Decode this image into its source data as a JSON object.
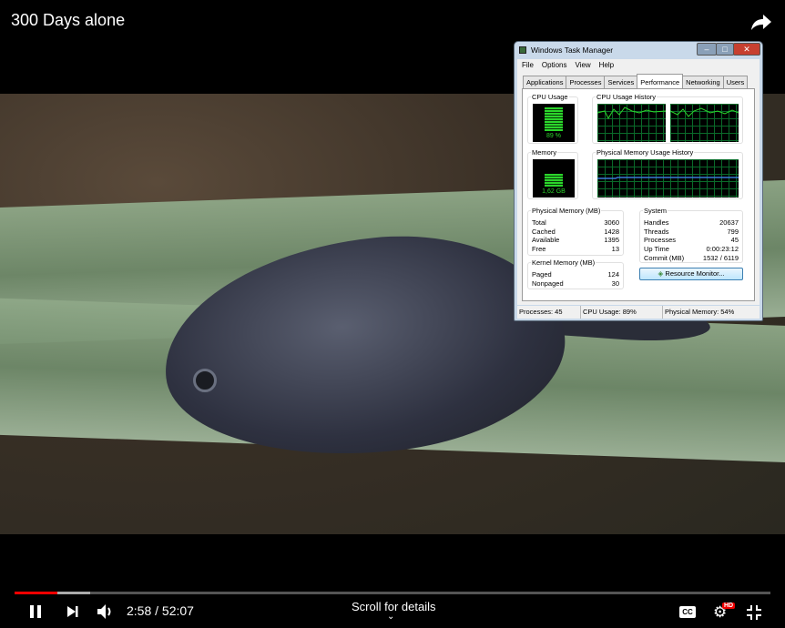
{
  "video": {
    "title": "300 Days alone",
    "share_icon": "share-icon"
  },
  "task_manager": {
    "title": "Windows Task Manager",
    "window_buttons": {
      "minimize": "–",
      "maximize": "□",
      "close": "✕"
    },
    "menu": [
      "File",
      "Options",
      "View",
      "Help"
    ],
    "tabs": [
      "Applications",
      "Processes",
      "Services",
      "Performance",
      "Networking",
      "Users"
    ],
    "active_tab": "Performance",
    "cpu_usage": {
      "label": "CPU Usage",
      "value": "89 %",
      "percent": 89
    },
    "cpu_history": {
      "label": "CPU Usage History"
    },
    "memory": {
      "label": "Memory",
      "value": "1,62 GB",
      "percent": 54
    },
    "memory_history": {
      "label": "Physical Memory Usage History"
    },
    "physical_memory": {
      "label": "Physical Memory (MB)",
      "rows": [
        [
          "Total",
          "3060"
        ],
        [
          "Cached",
          "1428"
        ],
        [
          "Available",
          "1395"
        ],
        [
          "Free",
          "13"
        ]
      ]
    },
    "kernel_memory": {
      "label": "Kernel Memory (MB)",
      "rows": [
        [
          "Paged",
          "124"
        ],
        [
          "Nonpaged",
          "30"
        ]
      ]
    },
    "system": {
      "label": "System",
      "rows": [
        [
          "Handles",
          "20637"
        ],
        [
          "Threads",
          "799"
        ],
        [
          "Processes",
          "45"
        ],
        [
          "Up Time",
          "0:00:23:12"
        ],
        [
          "Commit (MB)",
          "1532 / 6119"
        ]
      ]
    },
    "resource_monitor_button": "Resource Monitor...",
    "status": {
      "processes": "Processes: 45",
      "cpu": "CPU Usage: 89%",
      "memory": "Physical Memory: 54%"
    }
  },
  "player": {
    "time": "2:58 / 52:07",
    "progress_percent": 5.7,
    "buffered_percent": 10,
    "scroll_hint": "Scroll for details",
    "hd_badge": "HD",
    "cc_label": "CC",
    "colors": {
      "played": "#ff0000",
      "buffered": "#aaaaaa"
    }
  }
}
